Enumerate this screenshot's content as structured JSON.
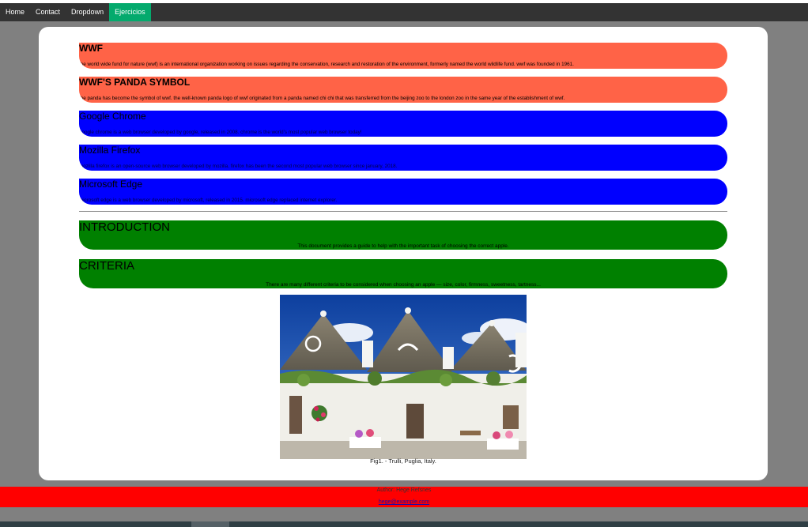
{
  "nav": {
    "items": [
      {
        "label": "Home",
        "active": false
      },
      {
        "label": "Contact",
        "active": false
      },
      {
        "label": "Dropdown",
        "active": false
      },
      {
        "label": "Ejercicios",
        "active": true
      }
    ],
    "active_color": "#04AA6D"
  },
  "sections": [
    {
      "title": "WWF",
      "text": "the world wide fund for nature (wwf) is an international organization working on issues regarding the conservation, research and restoration of the environment, formerly named the world wildlife fund. wwf was founded in 1961.",
      "color": "tomato"
    },
    {
      "title": "WWF'S PANDA SYMBOL",
      "text": "the panda has become the symbol of wwf. the well-known panda logo of wwf originated from a panda named chi chi that was transferred from the beijing zoo to the london zoo in the same year of the establishment of wwf.",
      "color": "tomato"
    },
    {
      "title": "Google Chrome",
      "text": "google chrome is a web browser developed by google, released in 2008. chrome is the world's most popular web browser today!",
      "color": "#0000ff"
    },
    {
      "title": "Mozilla Firefox",
      "text": "mozilla firefox is an open-source web browser developed by mozilla. firefox has been the second most popular web browser since january, 2018.",
      "color": "#0000ff"
    },
    {
      "title": "Microsoft Edge",
      "text": "microsoft edge is a web browser developed by microsoft, released in 2015. microsoft edge replaced internet explorer.",
      "color": "#0000ff"
    }
  ],
  "articles": [
    {
      "title": "INTRODUCTION",
      "text": "This document provides a guide to help with the important task of choosing the correct apple.",
      "color": "#008000"
    },
    {
      "title": "CRITERIA",
      "text": "There are many different criteria to be considered when choosing an apple — size, color, firmness, sweetness, tartness...",
      "color": "#008000"
    }
  ],
  "figure": {
    "caption": "Fig1. - Trulli, Puglia, Italy."
  },
  "footer": {
    "author": "Author: Hege Refsnes",
    "email": "hege@example.com",
    "color": "#ff0000"
  }
}
